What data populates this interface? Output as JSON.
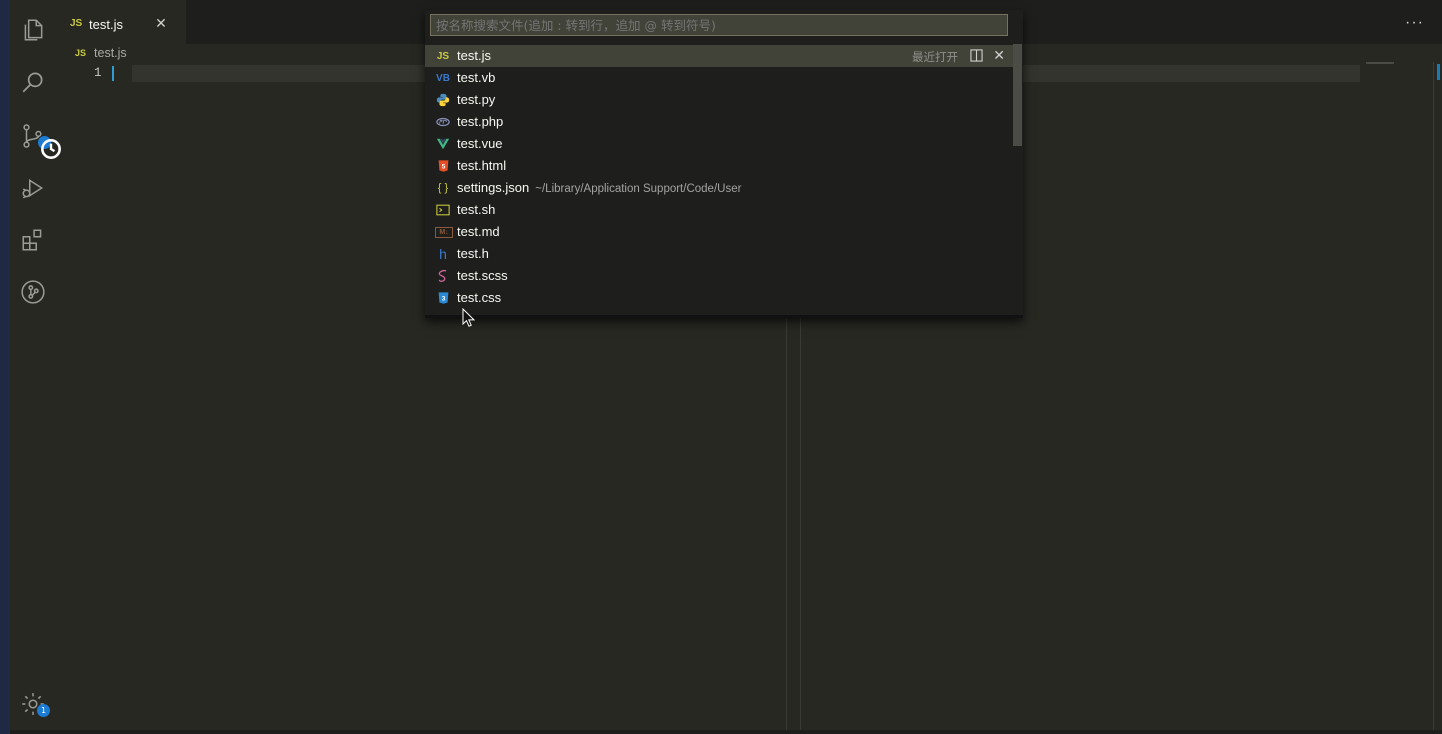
{
  "tab": {
    "badge": "JS",
    "label": "test.js",
    "close": "✕"
  },
  "tab_bar": {
    "more": "···"
  },
  "breadcrumb": {
    "badge": "JS",
    "label": "test.js"
  },
  "editor": {
    "line_number": "1"
  },
  "activity_bar": {
    "scm_badge": "",
    "settings_badge": "1"
  },
  "quick_open": {
    "placeholder": "按名称搜索文件(追加 : 转到行，追加 @ 转到符号)",
    "recently_opened": "最近打开",
    "remove": "✕",
    "items": [
      {
        "name": "test.js",
        "desc": "",
        "icon": "js-icon",
        "glyph": "JS",
        "color": "#cbcb41"
      },
      {
        "name": "test.vb",
        "desc": "",
        "icon": "vb-icon",
        "glyph": "VB",
        "color": "#3a78c9"
      },
      {
        "name": "test.py",
        "desc": "",
        "icon": "python-icon",
        "glyph": "",
        "color": "#4b8bbe"
      },
      {
        "name": "test.php",
        "desc": "",
        "icon": "php-icon",
        "glyph": "",
        "color": "#8993be"
      },
      {
        "name": "test.vue",
        "desc": "",
        "icon": "vue-icon",
        "glyph": "",
        "color": "#41b883"
      },
      {
        "name": "test.html",
        "desc": "",
        "icon": "html-icon",
        "glyph": "5",
        "color": "#e44d26"
      },
      {
        "name": "settings.json",
        "desc": "~/Library/Application Support/Code/User",
        "icon": "json-icon",
        "glyph": "{ }",
        "color": "#cbcb41"
      },
      {
        "name": "test.sh",
        "desc": "",
        "icon": "shell-icon",
        "glyph": "",
        "color": "#cbcb41"
      },
      {
        "name": "test.md",
        "desc": "",
        "icon": "markdown-icon",
        "glyph": "M↓",
        "color": "#8a5a3a"
      },
      {
        "name": "test.h",
        "desc": "",
        "icon": "h-icon",
        "glyph": "h",
        "color": "#3a78c9"
      },
      {
        "name": "test.scss",
        "desc": "",
        "icon": "scss-icon",
        "glyph": "",
        "color": "#cd6799"
      },
      {
        "name": "test.css",
        "desc": "",
        "icon": "css-icon",
        "glyph": "3",
        "color": "#2a8ad6"
      }
    ]
  }
}
